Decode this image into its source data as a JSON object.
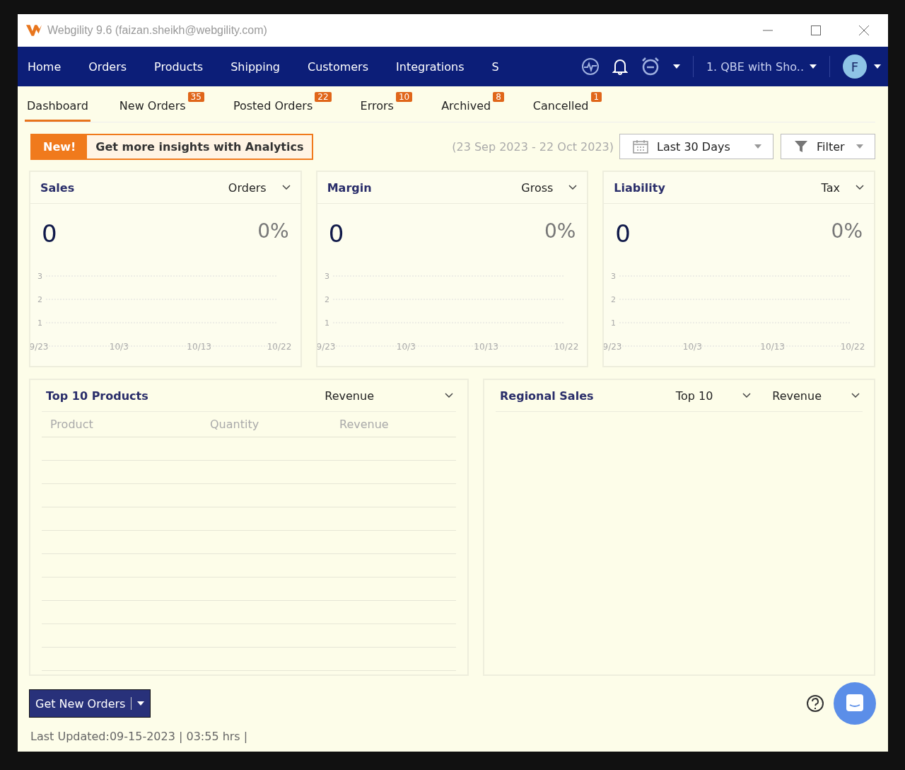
{
  "window": {
    "title": "Webgility 9.6 (faizan.sheikh@webgility.com)"
  },
  "nav": {
    "items": [
      {
        "label": "Home"
      },
      {
        "label": "Orders"
      },
      {
        "label": "Products"
      },
      {
        "label": "Shipping"
      },
      {
        "label": "Customers"
      },
      {
        "label": "Integrations"
      },
      {
        "label": "S"
      }
    ],
    "store_selector": "1. QBE with Sho..",
    "avatar": "F"
  },
  "tabs": [
    {
      "label": "Dashboard",
      "selected": true
    },
    {
      "label": "New Orders",
      "count": "35",
      "selected": false
    },
    {
      "label": "Posted Orders",
      "count": "22",
      "selected": false
    },
    {
      "label": "Errors",
      "count": "10",
      "selected": false
    },
    {
      "label": "Archived",
      "count": "8",
      "selected": false
    },
    {
      "label": "Cancelled",
      "count": "1",
      "selected": false
    }
  ],
  "toolbar": {
    "new_badge": "New!",
    "promo": "Get more insights with Analytics",
    "date_range": "(23 Sep 2023 - 22 Oct 2023)",
    "period": "Last 30 Days",
    "filter": "Filter"
  },
  "metric_cards": [
    {
      "title": "Sales",
      "dropdown": "Orders",
      "value": "0",
      "change": "0%",
      "chart_data": {
        "type": "line",
        "categories": [
          "9/23",
          "10/3",
          "10/13",
          "10/22"
        ],
        "ylim": [
          0,
          3
        ],
        "yticks": [
          1,
          2,
          3
        ]
      }
    },
    {
      "title": "Margin",
      "dropdown": "Gross",
      "value": "0",
      "change": "0%",
      "chart_data": {
        "type": "line",
        "categories": [
          "9/23",
          "10/3",
          "10/13",
          "10/22"
        ],
        "ylim": [
          0,
          3
        ],
        "yticks": [
          1,
          2,
          3
        ]
      }
    },
    {
      "title": "Liability",
      "dropdown": "Tax",
      "value": "0",
      "change": "0%",
      "chart_data": {
        "type": "line",
        "categories": [
          "9/23",
          "10/3",
          "10/13",
          "10/22"
        ],
        "ylim": [
          0,
          3
        ],
        "yticks": [
          1,
          2,
          3
        ]
      }
    }
  ],
  "top_products": {
    "title": "Top 10 Products",
    "dropdown": "Revenue",
    "columns": [
      "Product",
      "Quantity",
      "Revenue"
    ]
  },
  "regional_sales": {
    "title": "Regional Sales",
    "dropdowns": [
      "Top 10",
      "Revenue"
    ]
  },
  "get_orders_button": "Get New Orders",
  "status_bar": "Last Updated:09-15-2023 | 03:55 hrs |"
}
